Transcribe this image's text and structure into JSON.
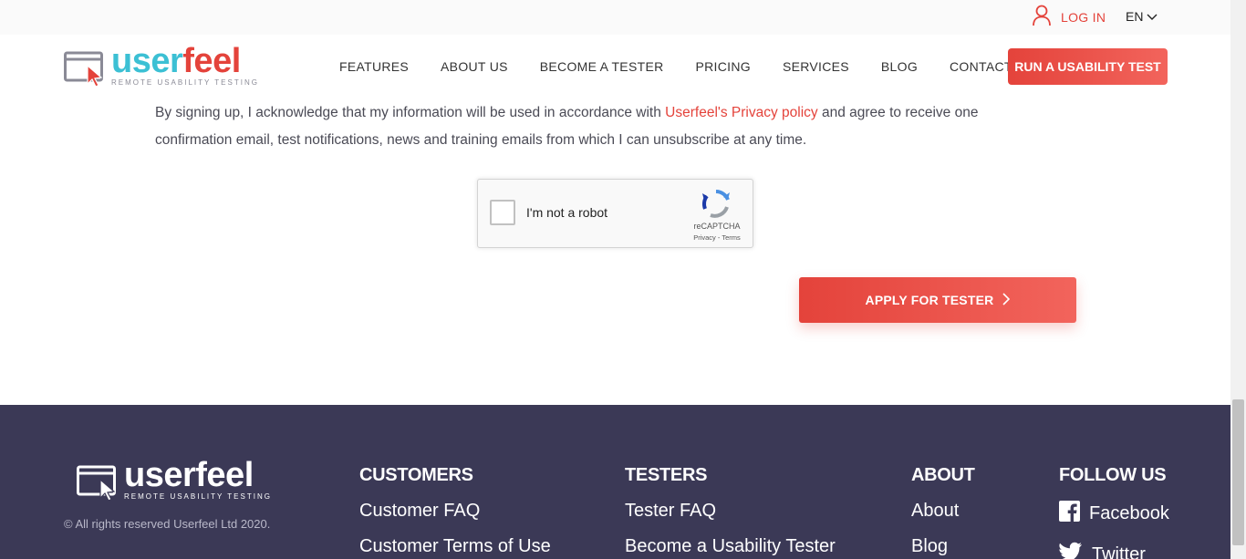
{
  "topbar": {
    "login_label": "LOG IN",
    "language": "EN"
  },
  "logo": {
    "word_user": "user",
    "word_feel": "feel",
    "tagline": "REMOTE USABILITY TESTING"
  },
  "nav": {
    "items": [
      "FEATURES",
      "ABOUT US",
      "BECOME A TESTER",
      "PRICING",
      "SERVICES",
      "BLOG",
      "CONTACT"
    ],
    "cta_label": "RUN A USABILITY TEST"
  },
  "consent": {
    "text_before": "By signing up, I acknowledge that my information will be used in accordance with ",
    "link_text": "Userfeel's Privacy policy",
    "text_after": " and agree to receive one confirmation email, test notifications, news and training emails from which I can unsubscribe at any time."
  },
  "captcha": {
    "label": "I'm not a robot",
    "brand": "reCAPTCHA",
    "terms": "Privacy - Terms"
  },
  "apply_button": {
    "label": "APPLY FOR TESTER"
  },
  "footer": {
    "logo_word": "userfeel",
    "tagline": "REMOTE USABILITY TESTING",
    "copyright": "© All rights reserved Userfeel Ltd 2020.",
    "columns": [
      {
        "title": "CUSTOMERS",
        "links": [
          "Customer FAQ",
          "Customer Terms of Use"
        ]
      },
      {
        "title": "TESTERS",
        "links": [
          "Tester FAQ",
          "Become a Usability Tester"
        ]
      },
      {
        "title": "ABOUT",
        "links": [
          "About",
          "Blog"
        ]
      },
      {
        "title": "FOLLOW US",
        "links": [
          "Facebook",
          "Twitter"
        ]
      }
    ]
  },
  "colors": {
    "brand_red": "#e4433b",
    "brand_cyan": "#3cc0d4",
    "footer_bg": "#3b3956"
  }
}
